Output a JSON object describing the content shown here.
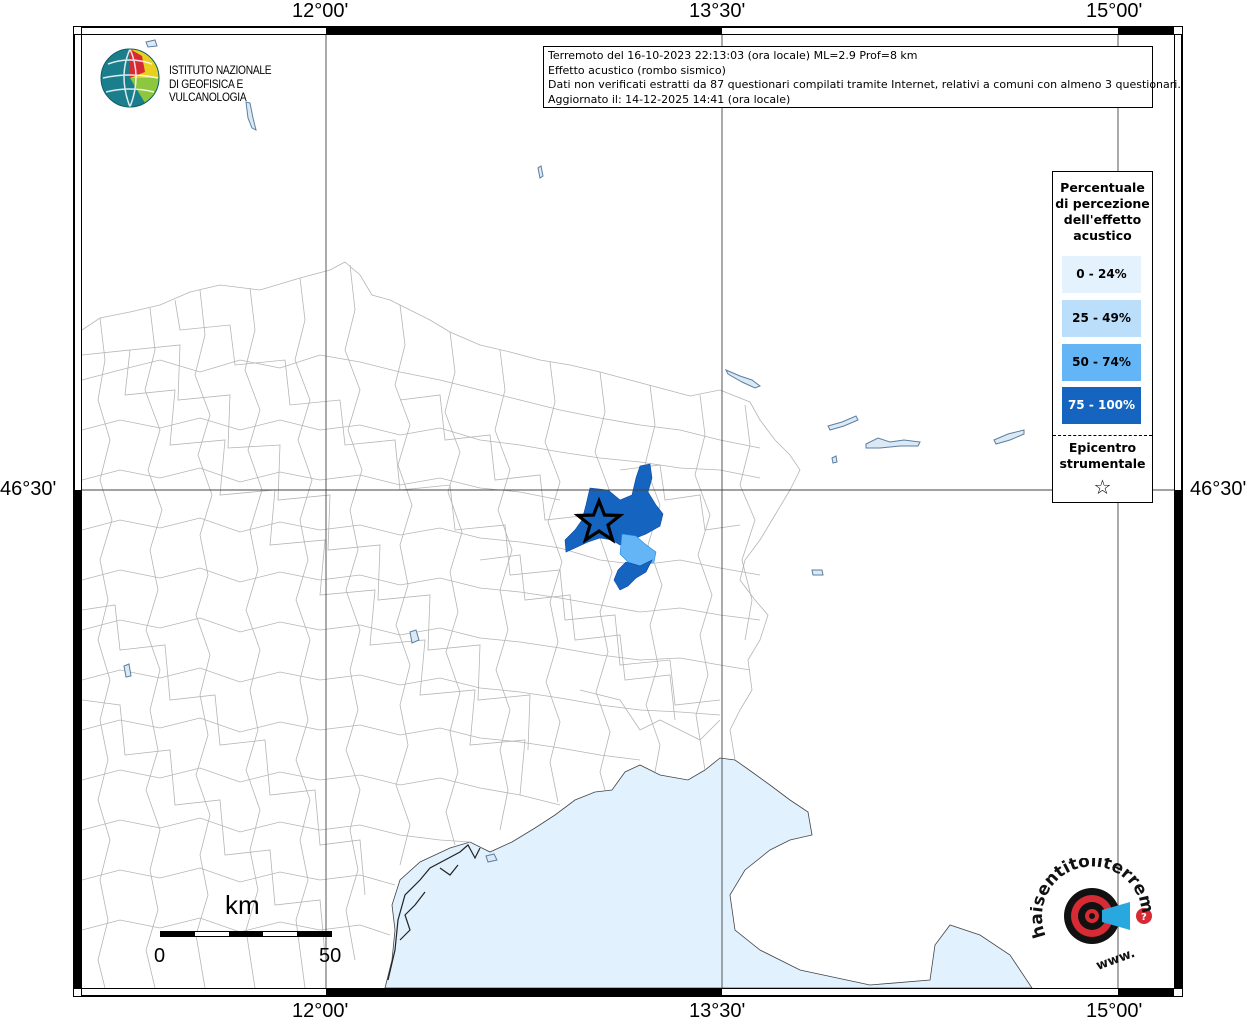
{
  "logo": {
    "line1": "ISTITUTO NAZIONALE",
    "line2": "DI GEOFISICA E VULCANOLOGIA"
  },
  "info": {
    "line1": "Terremoto del 16-10-2023 22:13:03 (ora locale) ML=2.9 Prof=8 km",
    "line2": "Effetto acustico (rombo sismico)",
    "line3": "Dati non verificati estratti da 87 questionari compilati tramite Internet, relativi a comuni con almeno 3 questionari.",
    "line4": "Aggiornato il: 14-12-2025 14:41 (ora locale)"
  },
  "axes": {
    "lon_top": [
      "12°00'",
      "13°30'",
      "15°00'"
    ],
    "lon_bottom": [
      "12°00'",
      "13°30'",
      "15°00'"
    ],
    "lat_left": "46°30'",
    "lat_right": "46°30'"
  },
  "legend": {
    "title_lines": [
      "Percentuale",
      "di percezione",
      "dell'effetto",
      "acustico"
    ],
    "classes": [
      {
        "label": "0 - 24%",
        "color": "#e3f2fd",
        "text_color": "#000000"
      },
      {
        "label": "25 - 49%",
        "color": "#bbdefb",
        "text_color": "#000000"
      },
      {
        "label": "50 - 74%",
        "color": "#64b5f6",
        "text_color": "#000000"
      },
      {
        "label": "75 - 100%",
        "color": "#1565c0",
        "text_color": "#ffffff"
      }
    ],
    "epicenter_lines": [
      "Epicentro",
      "strumentale"
    ],
    "epicenter_symbol": "☆"
  },
  "scalebar": {
    "unit": "km",
    "min": "0",
    "max": "50"
  },
  "colors": {
    "sea": "#e1f1fd",
    "lake_outline": "#5b7ea0",
    "municipal_border": "#b5b5b5",
    "high_class": "#1565c0",
    "mid_class": "#64b5f6"
  },
  "badge": {
    "text": "haisentitoilterremoto.it",
    "www": "www.",
    "icon": "target-icon"
  }
}
